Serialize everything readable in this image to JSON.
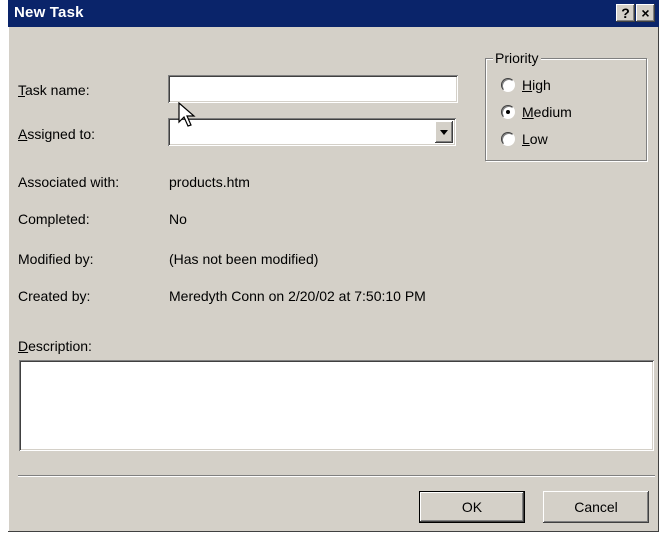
{
  "window": {
    "title": "New Task",
    "help_label": "?",
    "close_label": "×"
  },
  "form": {
    "task_name": {
      "label_key": "T",
      "label_rest": "ask name:",
      "value": ""
    },
    "assigned_to": {
      "label_key": "A",
      "label_rest": "ssigned to:",
      "value": ""
    },
    "associated_with": {
      "label": "Associated with:",
      "value": "products.htm"
    },
    "completed": {
      "label": "Completed:",
      "value": "No"
    },
    "modified_by": {
      "label": "Modified by:",
      "value": "(Has not been modified)"
    },
    "created_by": {
      "label": "Created by:",
      "value": "Meredyth Conn on 2/20/02 at 7:50:10 PM"
    },
    "description": {
      "label_key": "D",
      "label_rest": "escription:",
      "value": ""
    }
  },
  "priority": {
    "legend": "Priority",
    "selected": "Medium",
    "options": [
      {
        "key": "H",
        "rest": "igh",
        "selected": false
      },
      {
        "key": "M",
        "rest": "edium",
        "selected": true
      },
      {
        "key": "L",
        "rest": "ow",
        "selected": false
      }
    ]
  },
  "buttons": {
    "ok": "OK",
    "cancel": "Cancel"
  },
  "colors": {
    "titlebar": "#0a246a",
    "dialog_face": "#d4d0c8"
  }
}
